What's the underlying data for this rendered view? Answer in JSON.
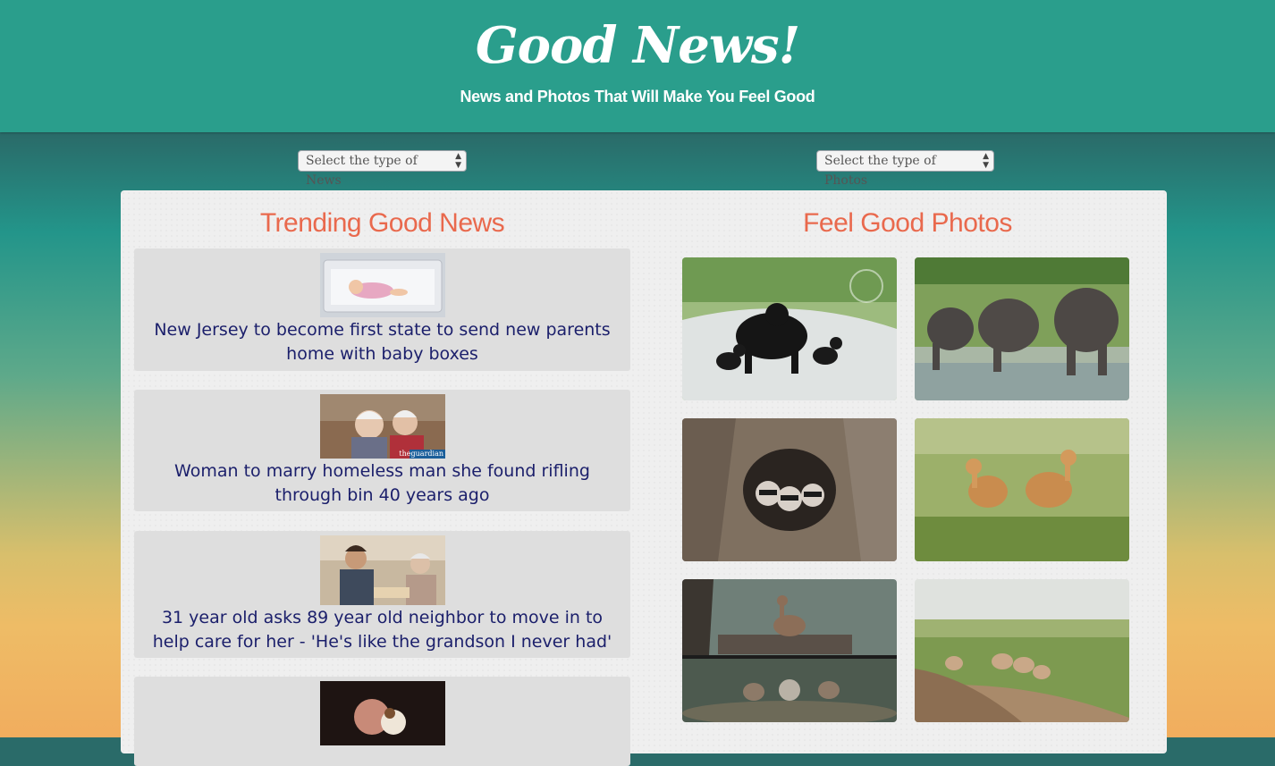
{
  "header": {
    "title": "Good News!",
    "subtitle": "News and Photos That Will Make You Feel Good"
  },
  "selects": {
    "news": "Select the type of News",
    "photos": "Select the type of Photos"
  },
  "news": {
    "heading": "Trending Good News",
    "items": [
      {
        "text": "New Jersey to become first state to send new parents home with baby boxes"
      },
      {
        "text": "Woman to marry homeless man she found rifling through bin 40 years ago",
        "thumb_caption": "theguardian"
      },
      {
        "text": "31 year old asks 89 year old neighbor to move in to help care for her - 'He's like the grandson I never had'"
      },
      {
        "text": ""
      }
    ]
  },
  "photos": {
    "heading": "Feel Good Photos",
    "items": [
      "black-bear-with-cubs",
      "elephants-at-water",
      "raccoons-in-tree-hollow",
      "crane-chicks-in-grass",
      "ducklings-on-rocks",
      "pronghorn-on-prairie-road"
    ]
  },
  "colors": {
    "header_bg": "#2a9e8c",
    "accent_title": "#e9694d",
    "news_text": "#1b1f6b",
    "card_bg": "#dedede"
  }
}
